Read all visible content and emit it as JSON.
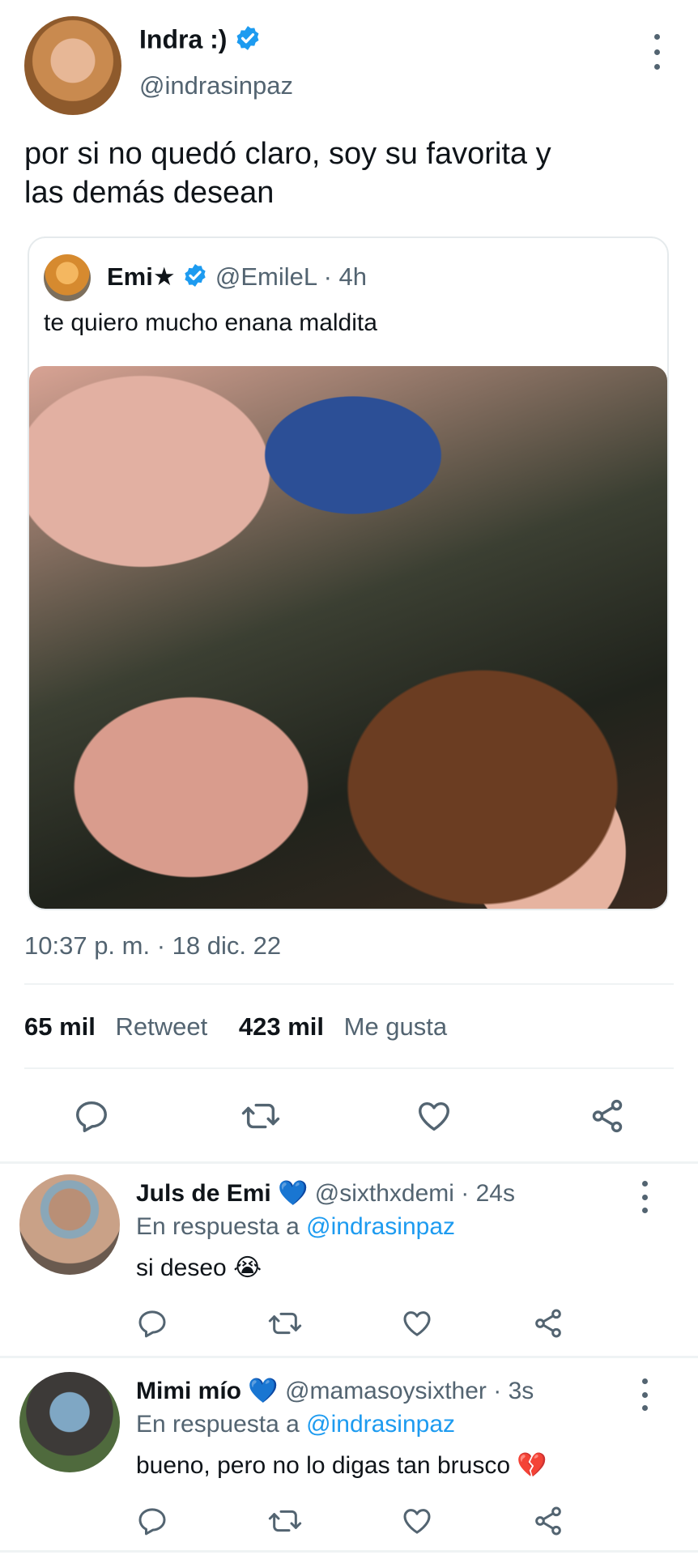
{
  "tweet": {
    "author_name": "Indra :)",
    "author_handle": "@indrasinpaz",
    "text_line1": "por si no quedó claro, soy su favorita y",
    "text_line2": "las demás desean",
    "timestamp": "10:37 p. m. · 18 dic. 22",
    "retweet_count": "65 mil",
    "retweet_label": "Retweet",
    "like_count": "423 mil",
    "like_label": "Me gusta"
  },
  "quoted": {
    "author_name": "Emi★",
    "author_handle": "@EmileL",
    "time": "· 4h",
    "text": "te quiero mucho enana maldita"
  },
  "replies": [
    {
      "name": "Juls de Emi",
      "emoji": "💙",
      "handle": "@sixthxdemi",
      "time": "· 24s",
      "reply_prefix": "En respuesta a",
      "reply_to": "@indrasinpaz",
      "text": "si deseo",
      "text_emoji": "😭"
    },
    {
      "name": "Mimi mío",
      "emoji": "💙",
      "handle": "@mamasoysixther",
      "time": "· 3s",
      "reply_prefix": "En respuesta a",
      "reply_to": "@indrasinpaz",
      "text": "bueno, pero no lo digas tan brusco",
      "text_emoji": "💔"
    }
  ],
  "colors": {
    "accent": "#1d9bf0",
    "muted": "#536471",
    "divider": "#eff3f4"
  },
  "icons": [
    "more-icon",
    "verified-badge-icon",
    "reply-icon",
    "retweet-icon",
    "like-icon",
    "share-icon"
  ]
}
